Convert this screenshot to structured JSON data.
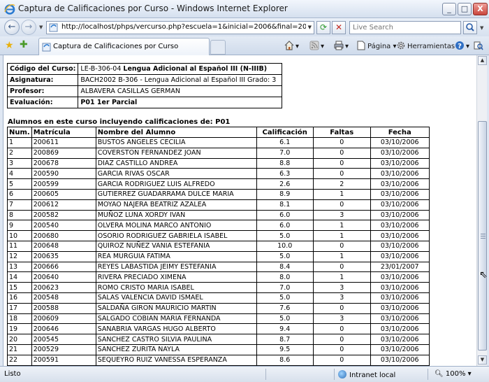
{
  "window": {
    "title": "Captura de Calificaciones por Curso - Windows Internet Explorer",
    "minimize": "_",
    "maximize": "□",
    "close": "X"
  },
  "addressbar": {
    "url": "http://localhost/phps/vercurso.php?escuela=1&inicial=2006&final=2006&periodo=1&co",
    "search_placeholder": "Live Search"
  },
  "tab": {
    "title": "Captura de Calificaciones por Curso"
  },
  "commands": {
    "pagina": "Página",
    "herramientas": "Herramientas"
  },
  "course": {
    "codigo_label": "Código del Curso:",
    "codigo_code": "LE-B-306-04",
    "codigo_name": "Lengua Adicional al Español III (N-IIIB)",
    "asignatura_label": "Asignatura:",
    "asignatura_value": "BACH2002 B-306 - Lengua Adicional al Español III  Grado: 3",
    "profesor_label": "Profesor:",
    "profesor_value": "ALBAVERA CASILLAS GERMAN",
    "evaluacion_label": "Evaluación:",
    "evaluacion_value": "P01 1er Parcial"
  },
  "section_title": "Alumnos en este curso incluyendo calificaciones de: P01",
  "table": {
    "headers": [
      "Num.",
      "Matrícula",
      "Nombre del Alumno",
      "Calificación",
      "Faltas",
      "Fecha"
    ],
    "rows": [
      [
        "1",
        "200611",
        "BUSTOS ANGELES CECILIA",
        "6.1",
        "0",
        "03/10/2006"
      ],
      [
        "2",
        "200869",
        "COVERSTON FERNANDEZ JOAN",
        "7.0",
        "0",
        "03/10/2006"
      ],
      [
        "3",
        "200678",
        "DIAZ CASTILLO ANDREA",
        "8.8",
        "0",
        "03/10/2006"
      ],
      [
        "4",
        "200590",
        "GARCIA RIVAS OSCAR",
        "6.3",
        "0",
        "03/10/2006"
      ],
      [
        "5",
        "200599",
        "GARCIA RODRIGUEZ LUIS ALFREDO",
        "2.6",
        "2",
        "03/10/2006"
      ],
      [
        "6",
        "200605",
        "GUTIERREZ GUADARRAMA DULCE MARIA",
        "8.9",
        "1",
        "03/10/2006"
      ],
      [
        "7",
        "200612",
        "MOYAO NAJERA BEATRIZ AZALEA",
        "8.1",
        "0",
        "03/10/2006"
      ],
      [
        "8",
        "200582",
        "MUÑOZ LUNA XORDY IVAN",
        "6.0",
        "3",
        "03/10/2006"
      ],
      [
        "9",
        "200540",
        "OLVERA MOLINA MARCO ANTONIO",
        "6.0",
        "1",
        "03/10/2006"
      ],
      [
        "10",
        "200680",
        "OSORIO RODRIGUEZ GABRIELA ISABEL",
        "5.0",
        "1",
        "03/10/2006"
      ],
      [
        "11",
        "200648",
        "QUIROZ NUÑEZ VANIA ESTEFANIA",
        "10.0",
        "0",
        "03/10/2006"
      ],
      [
        "12",
        "200635",
        "REA MURGUIA FATIMA",
        "5.0",
        "1",
        "03/10/2006"
      ],
      [
        "13",
        "200666",
        "REYES LABASTIDA JEIMY ESTEFANIA",
        "8.4",
        "0",
        "23/01/2007"
      ],
      [
        "14",
        "200640",
        "RIVERA PRECIADO XIMENA",
        "8.0",
        "1",
        "03/10/2006"
      ],
      [
        "15",
        "200623",
        "ROMO CRISTO MARIA ISABEL",
        "7.0",
        "3",
        "03/10/2006"
      ],
      [
        "16",
        "200548",
        "SALAS VALENCIA DAVID ISMAEL",
        "5.0",
        "3",
        "03/10/2006"
      ],
      [
        "17",
        "200588",
        "SALDAÑA GIRON MAURICIO MARTIN",
        "7.6",
        "0",
        "03/10/2006"
      ],
      [
        "18",
        "200609",
        "SALGADO COBIAN MARIA FERNANDA",
        "5.0",
        "3",
        "03/10/2006"
      ],
      [
        "19",
        "200646",
        "SANABRIA VARGAS HUGO ALBERTO",
        "9.4",
        "0",
        "03/10/2006"
      ],
      [
        "20",
        "200545",
        "SANCHEZ CASTRO SILVIA PAULINA",
        "8.7",
        "0",
        "03/10/2006"
      ],
      [
        "21",
        "200529",
        "SANCHEZ ZURITA NAYLA",
        "9.5",
        "0",
        "03/10/2006"
      ],
      [
        "22",
        "200591",
        "SEQUEYRO RUIZ VANESSA ESPERANZA",
        "8.6",
        "0",
        "03/10/2006"
      ]
    ]
  },
  "statusbar": {
    "status": "Listo",
    "zone": "Intranet local",
    "zoom": "100%"
  },
  "icons": {
    "back": "back-arrow-icon",
    "forward": "forward-arrow-icon",
    "refresh": "refresh-icon",
    "stop": "stop-icon",
    "search": "search-icon",
    "favorites": "favorites-star-icon",
    "add_favorites": "add-favorites-icon",
    "home": "home-icon",
    "feeds": "feeds-icon",
    "print": "print-icon",
    "page": "page-icon",
    "tools": "tools-gear-icon",
    "help": "help-icon",
    "research": "research-icon"
  }
}
